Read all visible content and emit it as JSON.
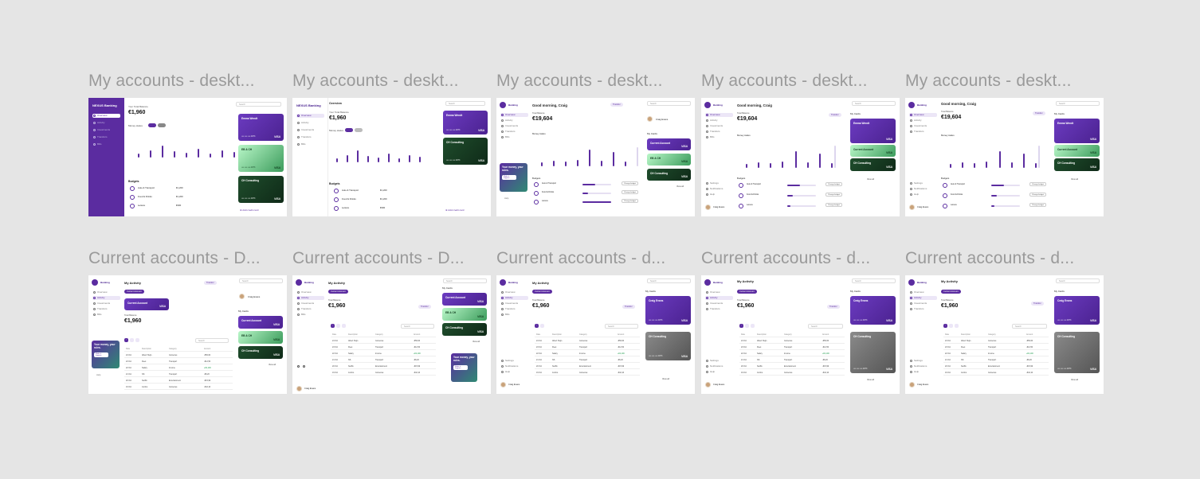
{
  "row1_label": "My accounts - deskt...",
  "row2_label": "Current accounts - D...",
  "row2_label_alt": "Current accounts - d...",
  "brand": "NEXUS Banking",
  "brand_short": "Banking",
  "your_total_balance": "Your Total Balance",
  "overview": "Overview",
  "total_balance": "Total Balance",
  "balance": "€1,960",
  "big_balance": "€19,604",
  "greeting": "Good morning, Craig",
  "money_status": "Money status",
  "transfer": "Transfer",
  "search": "Search",
  "budgets": "Budgets",
  "my_cards": "My Cards",
  "my_activity": "My Activity",
  "current_account": "Current Account",
  "add_credit_card": "Add credit card",
  "view_all": "View all",
  "user_name": "Craig Evans",
  "help": "Help",
  "settings": "Settings",
  "notifications": "Notifications",
  "nav": [
    "Overview",
    "Activity",
    "Investments",
    "Transfers",
    "Bills"
  ],
  "cards": [
    {
      "name": "Emma Wendt",
      "style": "c-purple"
    },
    {
      "name": "EB & CH",
      "style": "c-mint"
    },
    {
      "name": "CH Consulting",
      "style": "c-dark"
    }
  ],
  "card_nums": "•••• •••• •••• 4873",
  "visa": "VISA",
  "budget_items": [
    {
      "name": "Auto & Transport",
      "amount": "€1,200"
    },
    {
      "name": "Food & Drinks",
      "amount": "€1,200"
    },
    {
      "name": "Leisure",
      "amount": "€300"
    }
  ],
  "months": [
    "Jan",
    "Feb",
    "Mar",
    "Apr",
    "May",
    "Jun",
    "Jul",
    "Aug",
    "Sep"
  ],
  "promo": "Your money, your rules.",
  "promo_btn": "Make it happen",
  "table_headers": [
    "Date",
    "Description",
    "Category",
    "Amount"
  ],
  "table_rows": [
    {
      "date": "24 Oct",
      "desc": "Albert Heijn",
      "cat": "Groceries",
      "amt": "-€56,60"
    },
    {
      "date": "23 Oct",
      "desc": "Fleet",
      "cat": "Transport",
      "amt": "-€12,50"
    },
    {
      "date": "22 Oct",
      "desc": "Salary",
      "cat": "Income",
      "amt": "+€2,100"
    },
    {
      "date": "21 Oct",
      "desc": "NS",
      "cat": "Transport",
      "amt": "-€8,20"
    },
    {
      "date": "20 Oct",
      "desc": "Netflix",
      "cat": "Entertainment",
      "amt": "-€15,99"
    },
    {
      "date": "19 Oct",
      "desc": "Jumbo",
      "cat": "Groceries",
      "amt": "-€42,10"
    }
  ]
}
